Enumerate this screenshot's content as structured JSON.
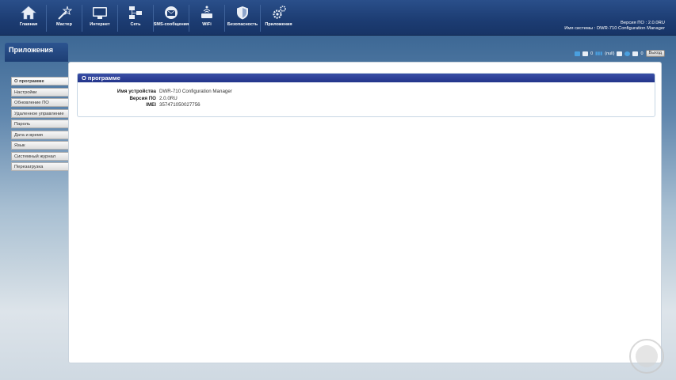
{
  "nav": [
    {
      "label": "Главная",
      "icon": "home-icon"
    },
    {
      "label": "Мастер",
      "icon": "wand-icon"
    },
    {
      "label": "Интернет",
      "icon": "monitor-icon"
    },
    {
      "label": "Сеть",
      "icon": "network-icon"
    },
    {
      "label": "SMS-сообщения",
      "icon": "envelope-icon"
    },
    {
      "label": "WiFi",
      "icon": "wifi-router-icon"
    },
    {
      "label": "Безопасность",
      "icon": "shield-icon"
    },
    {
      "label": "Приложения",
      "icon": "gears-icon"
    }
  ],
  "system": {
    "version_line": "Версия ПО : 2.0.0RU",
    "name_line": "Имя системы : DWR-710 Configuration Manager"
  },
  "status": {
    "mail_count": "0",
    "signal_text": "(null)",
    "sms_count": "0",
    "logout_label": "Выход"
  },
  "section_title": "Приложения",
  "sidebar": {
    "items": [
      "О программе",
      "Настройки",
      "Обновление ПО",
      "Удаленное управление",
      "Пароль",
      "Дата и время",
      "Язык",
      "Системный журнал",
      "Перезагрузка"
    ]
  },
  "panel": {
    "title": "О программе",
    "rows": [
      {
        "key": "Имя устройства",
        "value": "DWR-710 Configuration Manager"
      },
      {
        "key": "Версия ПО",
        "value": "2.0.0RU"
      },
      {
        "key": "IMEI",
        "value": "357471050027756"
      }
    ]
  }
}
